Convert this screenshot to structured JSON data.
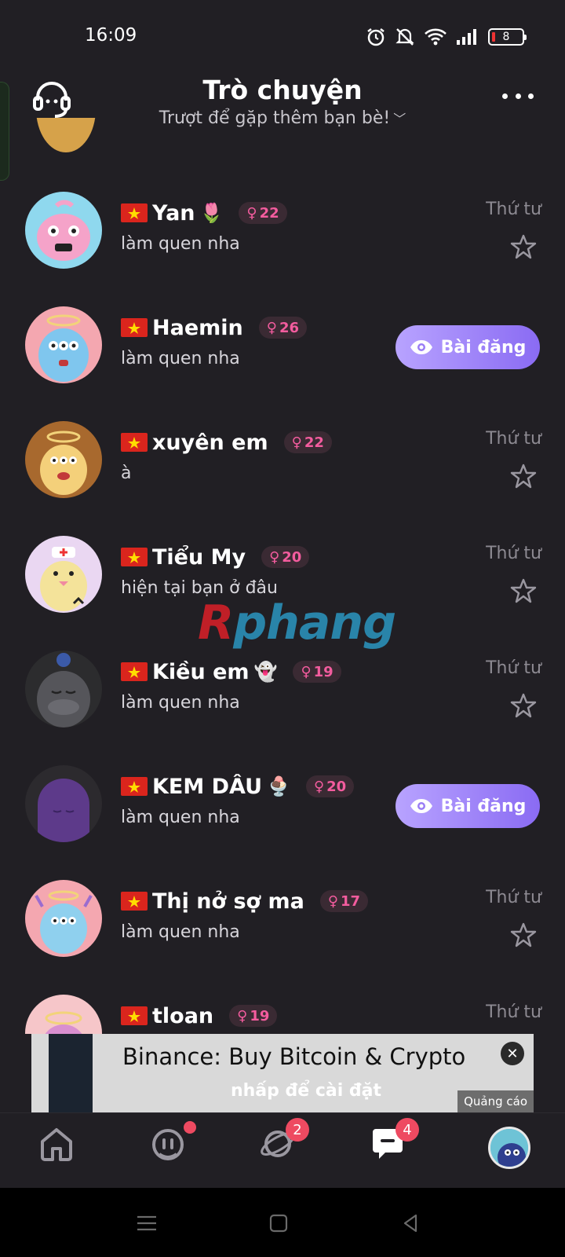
{
  "status": {
    "time": "16:09",
    "battery": "8"
  },
  "header": {
    "title": "Trò chuyện",
    "subtitle": "Trượt để gặp thêm bạn bè!"
  },
  "conversations": [
    {
      "name": "Yan",
      "emoji": "🌷",
      "age": "22",
      "message": "làm quen nha",
      "day": "Thứ tư",
      "action": "star",
      "avatar_color": "#8fd8ee"
    },
    {
      "name": "Haemin",
      "emoji": "",
      "age": "26",
      "message": "làm quen nha",
      "day": "",
      "action": "post",
      "post_label": "Bài đăng",
      "avatar_color": "#f4a7b0"
    },
    {
      "name": "xuyên em",
      "emoji": "",
      "age": "22",
      "message": "à",
      "day": "Thứ tư",
      "action": "star",
      "avatar_color": "#a8692e"
    },
    {
      "name": "Tiểu My",
      "emoji": "",
      "age": "20",
      "message": "hiện tại bạn ở đâu",
      "day": "Thứ tư",
      "action": "star",
      "avatar_color": "#ead7f2"
    },
    {
      "name": "Kiều em",
      "emoji": "👻",
      "age": "19",
      "message": "làm quen nha",
      "day": "Thứ tư",
      "action": "star",
      "avatar_color": "#2c2c2e"
    },
    {
      "name": "KEM DÂU",
      "emoji": "🍨",
      "age": "20",
      "message": "làm quen nha",
      "day": "",
      "action": "post",
      "post_label": "Bài đăng",
      "avatar_color": "#2c2a2e"
    },
    {
      "name": "Thị nở sợ ma",
      "emoji": "",
      "age": "17",
      "message": "làm quen nha",
      "day": "Thứ tư",
      "action": "star",
      "avatar_color": "#f4a7b0"
    },
    {
      "name": "tloan",
      "emoji": "",
      "age": "19",
      "message": "",
      "day": "Thứ tư",
      "action": "none",
      "avatar_color": "#f6c6c9"
    }
  ],
  "watermark": {
    "r": "R",
    "rest": "phang"
  },
  "ad": {
    "title": "Binance: Buy Bitcoin & Crypto",
    "cta": "nhấp để cài đặt",
    "label": "Quảng cáo",
    "close": "✕"
  },
  "tab_bar": {
    "tabs": [
      {
        "icon": "home-icon",
        "badge": ""
      },
      {
        "icon": "match-icon",
        "badge": "dot"
      },
      {
        "icon": "planet-icon",
        "badge": "2"
      },
      {
        "icon": "chat-icon",
        "badge": "4",
        "active": true
      },
      {
        "icon": "profile-avatar",
        "badge": ""
      }
    ]
  },
  "colors": {
    "background": "#211f24",
    "accent_pink": "#f35c9e",
    "post_button": "#9a7df5",
    "badge_red": "#ee4a61"
  }
}
